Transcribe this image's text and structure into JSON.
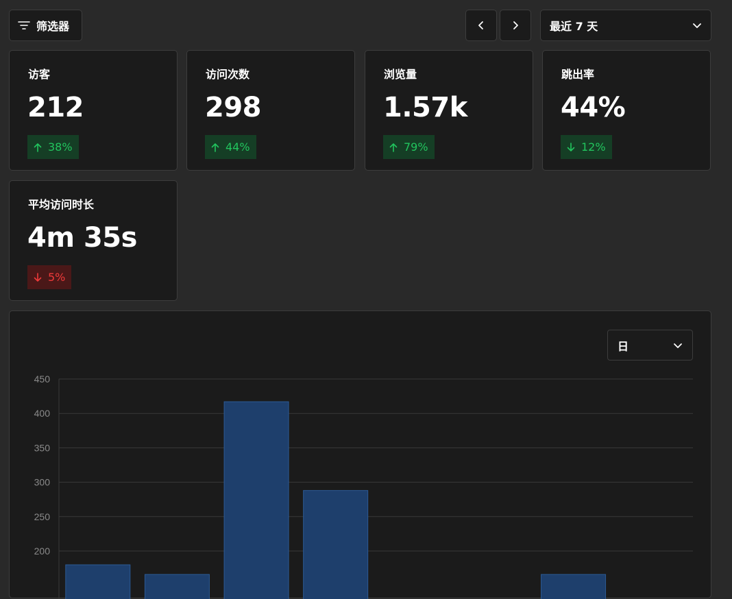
{
  "toolbar": {
    "filter_label": "筛选器",
    "date_range": "最近 7 天"
  },
  "metrics": [
    {
      "label": "访客",
      "value": "212",
      "change": "38%",
      "direction": "up",
      "sentiment": "good"
    },
    {
      "label": "访问次数",
      "value": "298",
      "change": "44%",
      "direction": "up",
      "sentiment": "good"
    },
    {
      "label": "浏览量",
      "value": "1.57k",
      "change": "79%",
      "direction": "up",
      "sentiment": "good"
    },
    {
      "label": "跳出率",
      "value": "44%",
      "change": "12%",
      "direction": "down",
      "sentiment": "good"
    },
    {
      "label": "平均访问时长",
      "value": "4m 35s",
      "change": "5%",
      "direction": "down",
      "sentiment": "bad"
    }
  ],
  "chart": {
    "unit_label": "日"
  },
  "chart_data": {
    "type": "bar",
    "ylim": [
      0,
      450
    ],
    "yticks": [
      200,
      250,
      300,
      350,
      400,
      450
    ],
    "values": [
      180,
      166,
      417,
      288,
      0,
      0,
      166,
      0
    ],
    "grid": true,
    "bar_color": "#1e3f6c",
    "bar_border": "#2c5a94"
  },
  "colors": {
    "good": "#22c55e",
    "bad": "#ef3a3a",
    "panel": "#1b1b1b",
    "background": "#292929"
  }
}
